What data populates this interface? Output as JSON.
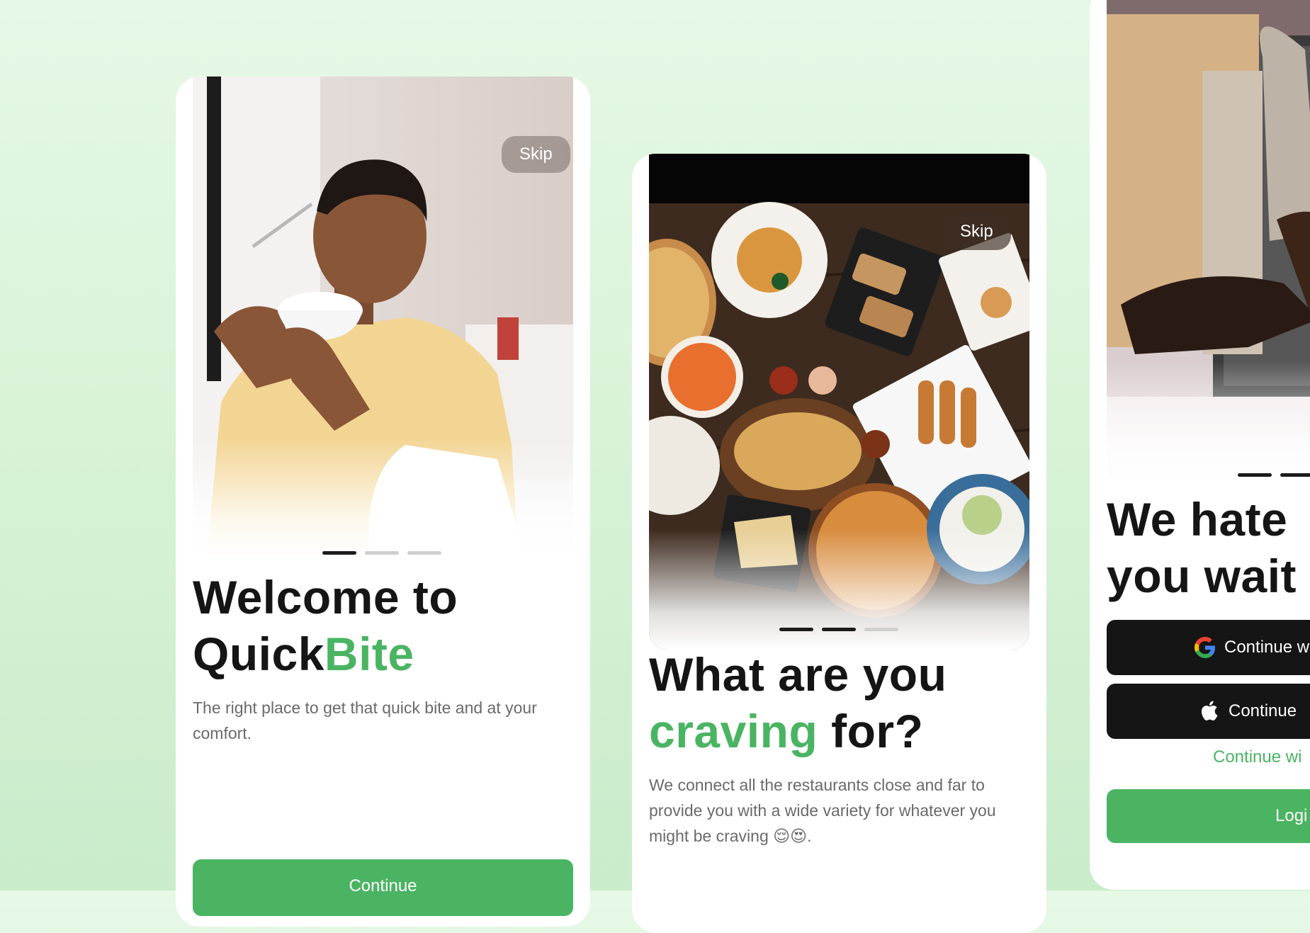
{
  "colors": {
    "accent": "#4ab462",
    "dark": "#151515",
    "background": "#e2f6e2"
  },
  "screens": [
    {
      "skip_label": "Skip",
      "title_line1": "Welcome to",
      "title_part": "Quick",
      "title_accent": "Bite",
      "description": "The right place to get that quick bite and at your comfort.",
      "continue_label": "Continue",
      "progress": {
        "current": 1,
        "total": 3
      }
    },
    {
      "skip_label": "Skip",
      "title_line1": "What are you",
      "title_accent": "craving",
      "title_rest": " for?",
      "description": "We connect all the restaurants close and far to provide you with a wide variety for whatever you might be craving 😌😍.",
      "progress": {
        "current": 2,
        "total": 3
      }
    },
    {
      "title_line1": "We hate",
      "title_line2": "you wait",
      "google_label": "Continue w",
      "apple_label": "Continue",
      "guest_label": "Continue wi",
      "login_label": "Logi",
      "progress": {
        "current": 3,
        "total": 3
      }
    }
  ]
}
